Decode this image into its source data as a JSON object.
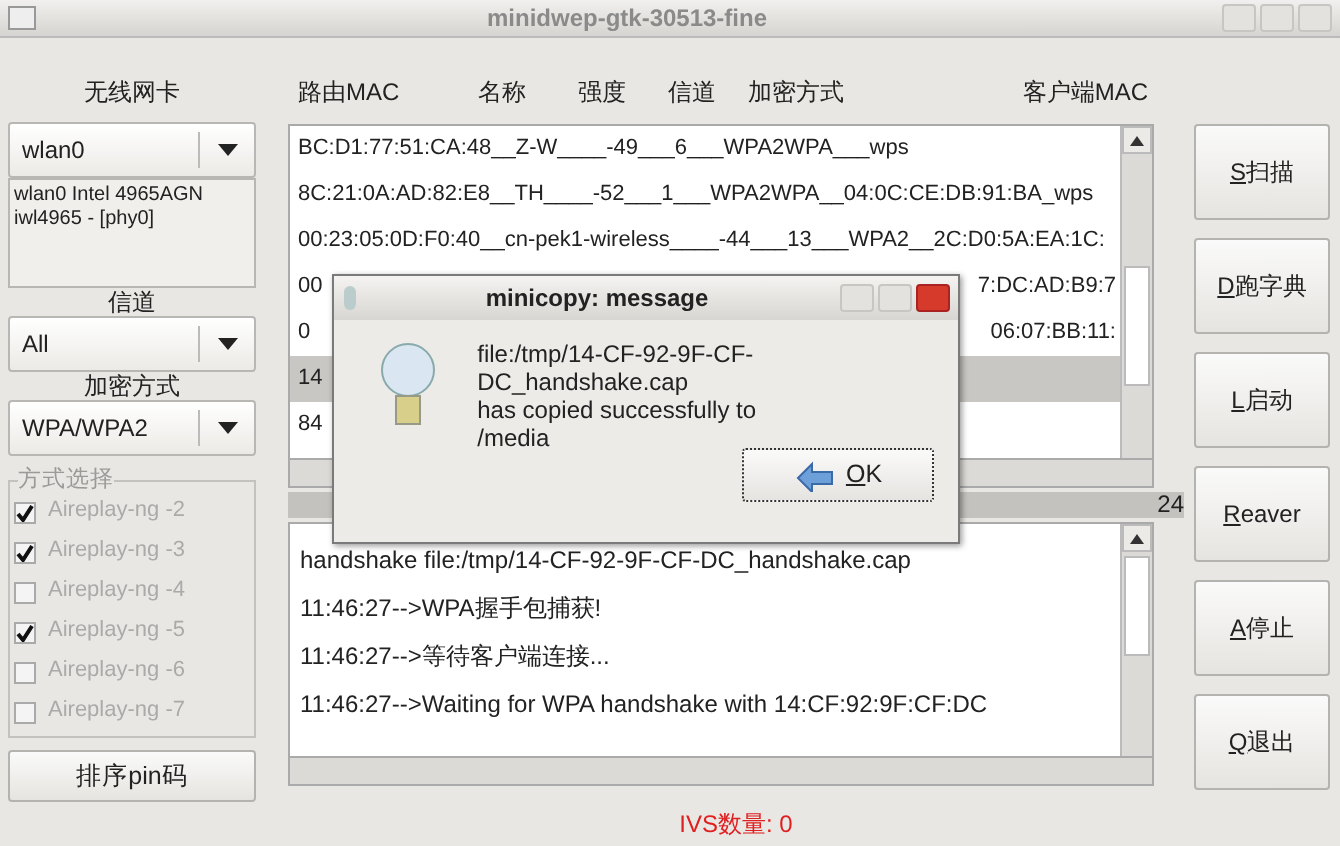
{
  "window": {
    "title": "minidwep-gtk-30513-fine"
  },
  "left_panel": {
    "card_label": "无线网卡",
    "card_select": "wlan0",
    "card_info": [
      "wlan0 Intel 4965AGN",
      "iwl4965 - [phy0]"
    ],
    "channel_label": "信道",
    "channel_select": "All",
    "encryption_label": "加密方式",
    "encryption_select": "WPA/WPA2",
    "method_group": {
      "title": "方式选择",
      "options": [
        {
          "label": "Aireplay-ng -2",
          "checked": true,
          "disabled": true
        },
        {
          "label": "Aireplay-ng -3",
          "checked": true,
          "disabled": true
        },
        {
          "label": "Aireplay-ng -4",
          "checked": false,
          "disabled": true
        },
        {
          "label": "Aireplay-ng -5",
          "checked": true,
          "disabled": true
        },
        {
          "label": "Aireplay-ng -6",
          "checked": false,
          "disabled": true
        },
        {
          "label": "Aireplay-ng -7",
          "checked": false,
          "disabled": true
        }
      ]
    },
    "pin_button": "排序pin码"
  },
  "network_list": {
    "columns": [
      "路由MAC",
      "名称",
      "强度",
      "信道",
      "加密方式",
      "客户端MAC"
    ],
    "rows": [
      {
        "start": "BC:D1:77:51:CA:48__Z-W____-49___6___WPA2WPA___wps",
        "selected": false
      },
      {
        "start": "8C:21:0A:AD:82:E8__TH____-52___1___WPA2WPA__04:0C:CE:DB:91:BA_wps",
        "selected": false
      },
      {
        "start": "00:23:05:0D:F0:40__cn-pek1-wireless____-44___13___WPA2__2C:D0:5A:EA:1C:",
        "selected": false
      },
      {
        "start": "00",
        "end": "7:DC:AD:B9:7",
        "selected": false
      },
      {
        "start": "0",
        "end": "06:07:BB:11:",
        "selected": false
      },
      {
        "start": "14",
        "selected": true
      },
      {
        "start": "84",
        "selected": false
      }
    ]
  },
  "progress": {
    "level": 1,
    "reading": "24"
  },
  "log": {
    "lines": [
      "handshake file:/tmp/14-CF-92-9F-CF-DC_handshake.cap",
      "11:46:27-->WPA握手包捕获!",
      "11:46:27-->等待客户端连接...",
      "11:46:27-->Waiting for WPA handshake with 14:CF:92:9F:CF:DC"
    ]
  },
  "action_buttons": [
    "S扫描",
    "D跑字典",
    "L启动",
    "Reaver",
    "A停止",
    "Q退出"
  ],
  "status": {
    "ivs": "IVS数量: 0"
  },
  "dialog": {
    "title": "minicopy: message",
    "message": [
      "file:/tmp/14-CF-92-9F-CF-DC_handshake.cap",
      "has copied successfully to",
      "/media"
    ],
    "ok_button": "OK"
  }
}
